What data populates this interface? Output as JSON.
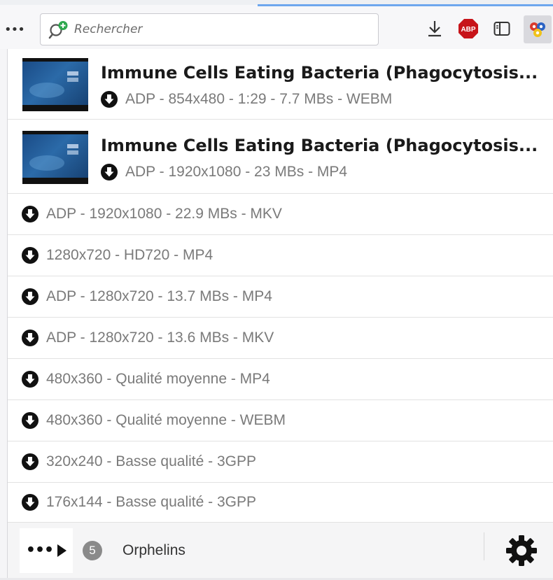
{
  "toolbar": {
    "overflow_label": "•••",
    "search": {
      "placeholder": "Rechercher",
      "value": ""
    },
    "buttons": [
      {
        "name": "download",
        "icon": "download-arrow-icon"
      },
      {
        "name": "adblock",
        "icon": "abp-icon",
        "label": "ABP",
        "color": "#c7141a"
      },
      {
        "name": "sidebar",
        "icon": "sidebar-icon"
      },
      {
        "name": "video-download-helper",
        "icon": "vdh-extension-icon",
        "active": true
      }
    ]
  },
  "popup": {
    "videos": [
      {
        "title": "Immune Cells Eating Bacteria (Phagocytosis...",
        "variant": "ADP - 854x480 - 1:29 - 7.7 MBs - WEBM"
      },
      {
        "title": "Immune Cells Eating Bacteria (Phagocytosis...",
        "variant": "ADP - 1920x1080 - 23 MBs - MP4"
      }
    ],
    "variants": [
      {
        "label": "ADP - 1920x1080 - 22.9 MBs - MKV"
      },
      {
        "label": "1280x720 - HD720 - MP4"
      },
      {
        "label": "ADP - 1280x720 - 13.7 MBs - MP4"
      },
      {
        "label": "ADP - 1280x720 - 13.6 MBs - MKV"
      },
      {
        "label": "480x360 - Qualité moyenne - MP4"
      },
      {
        "label": "480x360 - Qualité moyenne - WEBM"
      },
      {
        "label": "320x240 - Basse qualité - 3GPP"
      },
      {
        "label": "176x144 - Basse qualité - 3GPP"
      }
    ],
    "footer": {
      "more_label": "•••",
      "orphans_count": "5",
      "orphans_label": "Orphelins",
      "settings_icon": "gear-icon"
    }
  },
  "colors": {
    "accent_tab": "#6ea7ee",
    "abp_red": "#c7141a",
    "variant_text": "#7a7a7a",
    "title_text": "#1a1a1a",
    "badge_gray": "#8a8a8a"
  }
}
